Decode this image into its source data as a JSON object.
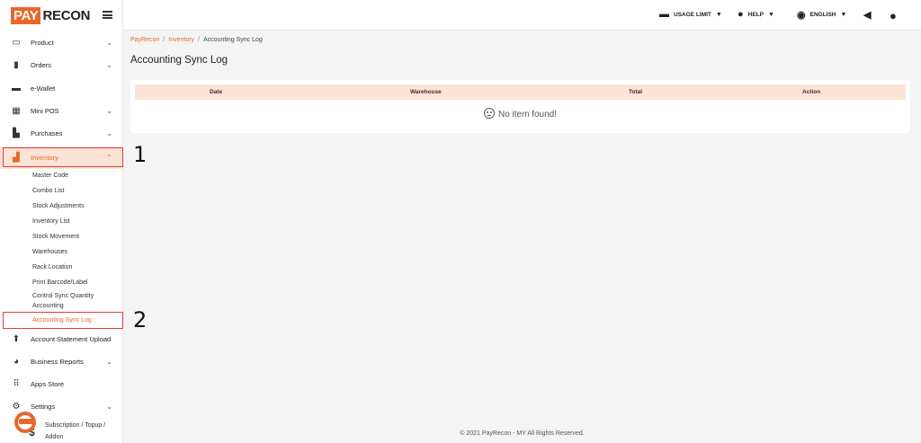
{
  "logo": {
    "pay": "PAY",
    "recon": "RECON"
  },
  "sidebar": {
    "items": [
      {
        "label": "Product",
        "icon": "inbox-icon"
      },
      {
        "label": "Orders",
        "icon": "clipboard-icon"
      },
      {
        "label": "e-Wallet",
        "icon": "wallet-icon"
      },
      {
        "label": "Mini POS",
        "icon": "cash-register-icon"
      },
      {
        "label": "Purchases",
        "icon": "dolly-icon"
      },
      {
        "label": "Inventory",
        "icon": "boxes-icon"
      },
      {
        "label": "Account Statement Upload",
        "icon": "upload-icon"
      },
      {
        "label": "Business Reports",
        "icon": "pie-chart-icon"
      },
      {
        "label": "Apps Store",
        "icon": "grid-icon"
      },
      {
        "label": "Settings",
        "icon": "gear-icon"
      }
    ],
    "inventory_sub": [
      "Master Code",
      "Combo List",
      "Stock Adjustments",
      "Inventory List",
      "Stock Movement",
      "Warehouses",
      "Rack Location",
      "Print Barcode/Label",
      "Control Sync Quantity",
      "Accounting",
      "Accounting Sync Log"
    ],
    "addon_line1": "Subscription / Topup /",
    "addon_line2": "Addon"
  },
  "annotations": {
    "step1": "1",
    "step2": "2"
  },
  "topbar": {
    "usage_limit": "USAGE LIMIT",
    "help": "HELP",
    "language": "ENGLISH"
  },
  "breadcrumb": {
    "root": "PayRecon",
    "section": "Inventory",
    "current": "Accounting Sync Log",
    "sep": "/"
  },
  "page_title": "Accounting Sync Log",
  "table": {
    "columns": [
      "Date",
      "Warehouse",
      "Total",
      "Action"
    ],
    "empty_text": "No item found!"
  },
  "footer": "© 2021 PayRecon - MY All Rights Reserved.",
  "colors": {
    "accent": "#e8672b",
    "accent_light": "#fde3d6",
    "annotation_red": "#e23b3b"
  }
}
